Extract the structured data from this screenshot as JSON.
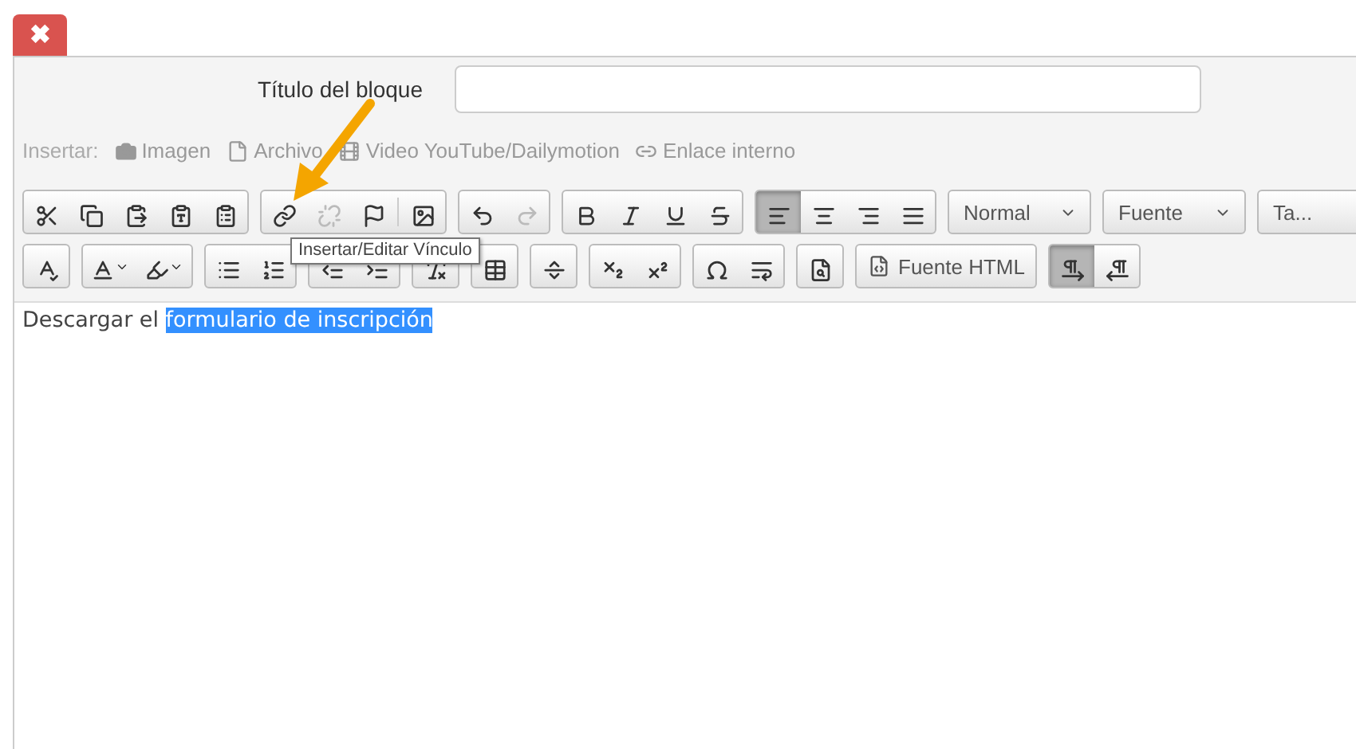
{
  "close_button": {
    "label": "✖"
  },
  "title_field": {
    "label": "Título del bloque"
  },
  "insert_bar": {
    "label": "Insertar:",
    "links": [
      {
        "label": "Imagen"
      },
      {
        "label": "Archivo"
      },
      {
        "label": "Video YouTube/Dailymotion"
      },
      {
        "label": "Enlace interno"
      }
    ]
  },
  "toolbar": {
    "rows": [
      [
        {
          "buttons": [
            {
              "kind": "icon"
            },
            {
              "kind": "icon"
            },
            {
              "kind": "icon"
            },
            {
              "kind": "icon"
            },
            {
              "kind": "icon"
            }
          ]
        },
        {
          "buttons": [
            {
              "kind": "icon",
              "disabled": false
            },
            {
              "kind": "icon",
              "disabled": true
            },
            {
              "kind": "icon",
              "disabled": false
            },
            {
              "kind": "icon",
              "disabled": false,
              "divider": true
            }
          ]
        },
        {
          "buttons": [
            {
              "kind": "icon",
              "disabled": false
            },
            {
              "kind": "icon",
              "disabled": true
            }
          ]
        },
        {
          "buttons": [
            {
              "kind": "icon"
            },
            {
              "kind": "icon"
            },
            {
              "kind": "icon"
            },
            {
              "kind": "icon"
            }
          ]
        },
        {
          "buttons": [
            {
              "kind": "icon",
              "selected": true
            },
            {
              "kind": "icon",
              "selected": false
            },
            {
              "kind": "icon",
              "selected": false
            },
            {
              "kind": "icon",
              "selected": false
            }
          ]
        },
        {
          "buttons": [
            {
              "kind": "dropdown",
              "label": "Normal"
            }
          ]
        },
        {
          "buttons": [
            {
              "kind": "dropdown",
              "label": "Fuente"
            }
          ]
        },
        {
          "buttons": [
            {
              "kind": "dropdown",
              "label": "Ta..."
            }
          ]
        }
      ],
      [
        {
          "buttons": [
            {
              "kind": "icon"
            }
          ]
        },
        {
          "buttons": [
            {
              "kind": "icon"
            },
            {
              "kind": "icon"
            }
          ]
        },
        {
          "buttons": [
            {
              "kind": "icon"
            },
            {
              "kind": "icon"
            }
          ]
        },
        {
          "buttons": [
            {
              "kind": "icon"
            },
            {
              "kind": "icon"
            }
          ]
        },
        {
          "buttons": [
            {
              "kind": "icon"
            }
          ]
        },
        {
          "buttons": [
            {
              "kind": "icon"
            }
          ]
        },
        {
          "buttons": [
            {
              "kind": "icon"
            }
          ]
        },
        {
          "buttons": [
            {
              "kind": "icon"
            },
            {
              "kind": "icon"
            }
          ]
        },
        {
          "buttons": [
            {
              "kind": "icon"
            },
            {
              "kind": "icon"
            }
          ]
        },
        {
          "buttons": [
            {
              "kind": "icon"
            }
          ]
        },
        {
          "buttons": [
            {
              "kind": "text",
              "label": "Fuente HTML"
            }
          ]
        },
        {
          "buttons": [
            {
              "kind": "icon",
              "selected": true
            },
            {
              "kind": "icon",
              "selected": false
            }
          ]
        }
      ]
    ]
  },
  "tooltip": {
    "text": "Insertar/Editar Vínculo"
  },
  "editor": {
    "text": "Descargar el",
    "selected_text": "formulario de inscripción"
  }
}
